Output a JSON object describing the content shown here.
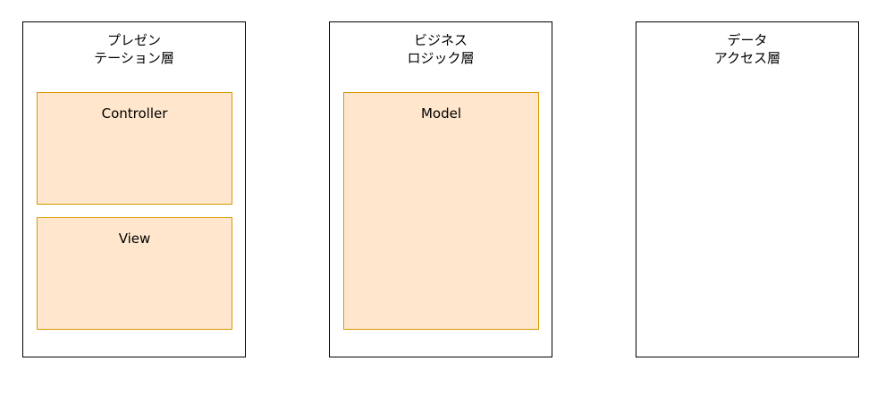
{
  "layers": [
    {
      "title_line1": "プレゼン",
      "title_line2": "テーション層",
      "components": [
        "Controller",
        "View"
      ]
    },
    {
      "title_line1": "ビジネス",
      "title_line2": "ロジック層",
      "components": [
        "Model"
      ]
    },
    {
      "title_line1": "データ",
      "title_line2": "アクセス層",
      "components": []
    }
  ],
  "colors": {
    "component_fill": "#ffe6cc",
    "component_border": "#d79b00",
    "layer_border": "#000000"
  }
}
